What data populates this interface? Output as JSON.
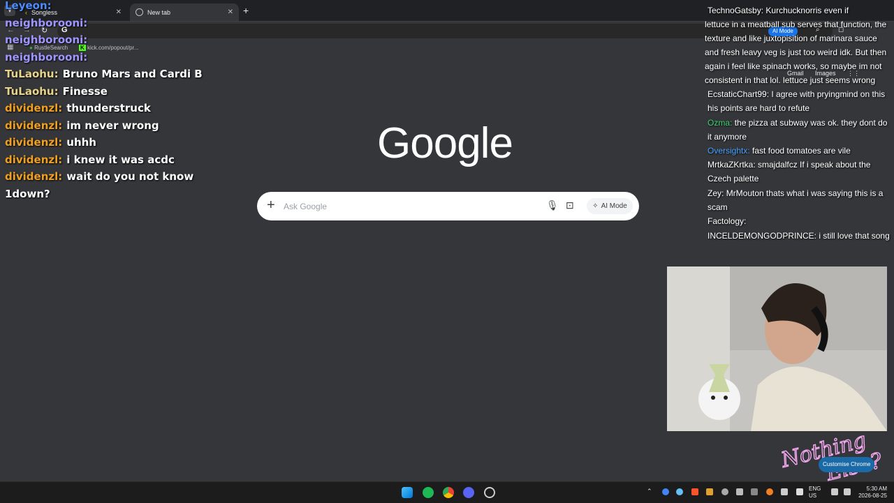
{
  "tabs": [
    {
      "label": "Songless",
      "active": false
    },
    {
      "label": "New tab",
      "active": true
    }
  ],
  "bookmarks": [
    {
      "label": "RustleSearch"
    },
    {
      "label": "kick.com/popout/pr..."
    }
  ],
  "chat_left": [
    {
      "user": "Leyeon:",
      "color": "#4d8cff",
      "text": ""
    },
    {
      "user": "neighborooni:",
      "color": "#9e95ff",
      "text": ""
    },
    {
      "user": "neighborooni:",
      "color": "#9e95ff",
      "text": ""
    },
    {
      "user": "neighborooni:",
      "color": "#9e95ff",
      "text": ""
    },
    {
      "user": "TuLaohu:",
      "color": "#e6d48a",
      "text": "Bruno Mars and Cardi B"
    },
    {
      "user": "TuLaohu:",
      "color": "#e6d48a",
      "text": "Finesse"
    },
    {
      "user": "dividenzl:",
      "color": "#f0a020",
      "text": "thunderstruck"
    },
    {
      "user": "dividenzl:",
      "color": "#f0a020",
      "text": "im never wrong"
    },
    {
      "user": "dividenzl:",
      "color": "#f0a020",
      "text": "uhhh"
    },
    {
      "user": "dividenzl:",
      "color": "#f0a020",
      "text": "i knew it was acdc"
    },
    {
      "user": "dividenzl:",
      "color": "#f0a020",
      "text": "wait do you not know"
    },
    {
      "user": "",
      "color": "#ffffff",
      "text": "1down?"
    }
  ],
  "google": {
    "logo": "Google",
    "placeholder": "Ask Google",
    "ai_mode": "AI Mode",
    "gmail": "Gmail",
    "images": "Images",
    "customise": "Customise Chrome"
  },
  "chat_right": [
    {
      "user": "TechnoGatsby:",
      "color": "#ffffff",
      "text": "Kurchucknorris even if"
    },
    {
      "user": "",
      "color": "#ffffff",
      "text": "lettuce in a meatball sub serves that function, the texture and like juxtopisition of marinara sauce and fresh leavy veg is just too weird idk. But then again i feel like spinach works, so maybe im not consistent in that lol. lettuce just seems wrong"
    },
    {
      "user": "EcstaticChart99:",
      "color": "#ffffff",
      "text": "I agree with pryingmind on this his points are hard to refute"
    },
    {
      "user": "Ozma:",
      "color": "#3cd070",
      "text": "the pizza at subway was ok. they dont do it anymore"
    },
    {
      "user": "Oversightx:",
      "color": "#4aa3ff",
      "text": "fast food tomatoes are vile"
    },
    {
      "user": "MrtkaZKrtka:",
      "color": "#ffffff",
      "text": "smajdalfcz   If i speak about the Czech palette"
    },
    {
      "user": "Zey:",
      "color": "#ffffff",
      "text": "MrMouton thats what i was saying this is a scam"
    },
    {
      "user": "Factology:",
      "color": "#ffffff",
      "text": ""
    },
    {
      "user": "INCELDEMONGODPRINCE:",
      "color": "#ffffff",
      "text": "i still love that song"
    }
  ],
  "overlay_logo": "Nothing Else?",
  "taskbar": {
    "lang1": "ENG",
    "lang2": "US",
    "time": "5:30 AM",
    "date": "2026-08-25"
  }
}
